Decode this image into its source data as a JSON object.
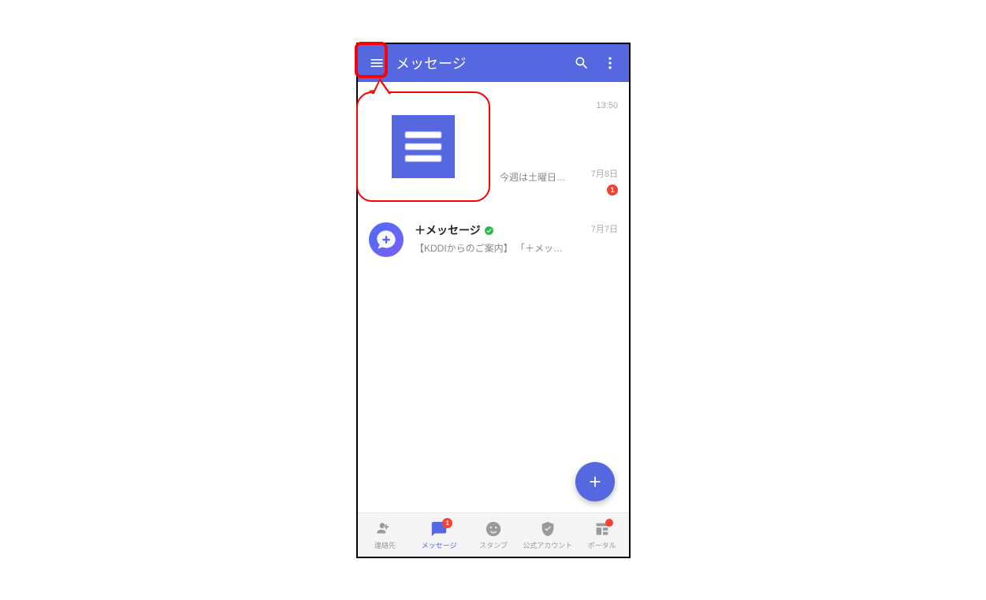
{
  "header": {
    "title": "メッセージ"
  },
  "chats": [
    {
      "time": "13:50"
    },
    {
      "snippet": "今週は土曜日も…",
      "time": "7月8日",
      "unread": "1"
    },
    {
      "name": "＋メッセージ",
      "snippet": "【KDDIからのご案内】 「＋メッセー…",
      "time": "7月7日"
    }
  ],
  "nav": {
    "contacts": "連絡先",
    "messages": "メッセージ",
    "messages_badge": "1",
    "stamps": "スタンプ",
    "official": "公式アカウント",
    "portal": "ポータル"
  }
}
